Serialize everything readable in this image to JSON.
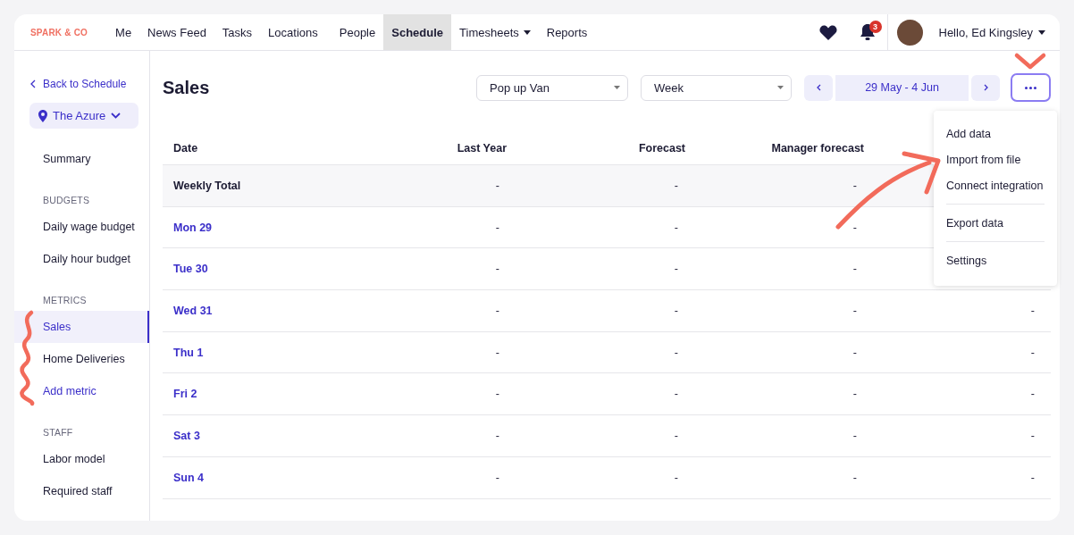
{
  "brand": "SPARK & CO",
  "nav": [
    {
      "label": "Me",
      "selected": false,
      "dropdown": false
    },
    {
      "label": "News Feed",
      "selected": false,
      "dropdown": false
    },
    {
      "label": "Tasks",
      "selected": false,
      "dropdown": false
    },
    {
      "label": "Locations",
      "selected": false,
      "dropdown": false
    },
    {
      "label": "People",
      "selected": false,
      "dropdown": false
    },
    {
      "label": "Schedule",
      "selected": true,
      "dropdown": false
    },
    {
      "label": "Timesheets",
      "selected": false,
      "dropdown": true
    },
    {
      "label": "Reports",
      "selected": false,
      "dropdown": false
    }
  ],
  "notifications": {
    "count": "3"
  },
  "user": {
    "greeting": "Hello, Ed Kingsley"
  },
  "sidebar": {
    "back_link": "Back to Schedule",
    "location": "The Azure",
    "sections": [
      {
        "items": [
          {
            "label": "Summary",
            "selected": false,
            "kind": "page"
          }
        ]
      },
      {
        "heading": "BUDGETS",
        "items": [
          {
            "label": "Daily wage budget",
            "selected": false,
            "kind": "page"
          },
          {
            "label": "Daily hour budget",
            "selected": false,
            "kind": "page"
          }
        ]
      },
      {
        "heading": "METRICS",
        "items": [
          {
            "label": "Sales",
            "selected": true,
            "kind": "page"
          },
          {
            "label": "Home Deliveries",
            "selected": false,
            "kind": "page"
          },
          {
            "label": "Add metric",
            "selected": false,
            "kind": "action"
          }
        ]
      },
      {
        "heading": "STAFF",
        "items": [
          {
            "label": "Labor model",
            "selected": false,
            "kind": "page"
          },
          {
            "label": "Required staff",
            "selected": false,
            "kind": "page"
          }
        ]
      }
    ]
  },
  "page": {
    "title": "Sales",
    "filters": [
      {
        "value": "Pop up Van"
      },
      {
        "value": "Week"
      }
    ],
    "date_range": "29 May - 4 Jun"
  },
  "menu": {
    "groups": [
      [
        "Add data",
        "Import from file",
        "Connect integration"
      ],
      [
        "Export data"
      ],
      [
        "Settings"
      ]
    ]
  },
  "table": {
    "columns": [
      "Date",
      "Last Year",
      "Forecast",
      "Manager forecast"
    ],
    "rows": [
      {
        "kind": "total",
        "cells": [
          "Weekly Total",
          "-",
          "-",
          "-"
        ]
      },
      {
        "kind": "day",
        "cells": [
          "Mon 29",
          "-",
          "-",
          "-"
        ]
      },
      {
        "kind": "day",
        "cells": [
          "Tue 30",
          "-",
          "-",
          "-"
        ]
      },
      {
        "kind": "day",
        "cells": [
          "Wed 31",
          "-",
          "-",
          "-",
          "-"
        ]
      },
      {
        "kind": "day",
        "cells": [
          "Thu 1",
          "-",
          "-",
          "-",
          "-"
        ]
      },
      {
        "kind": "day",
        "cells": [
          "Fri 2",
          "-",
          "-",
          "-",
          "-"
        ]
      },
      {
        "kind": "day",
        "cells": [
          "Sat 3",
          "-",
          "-",
          "-",
          "-"
        ]
      },
      {
        "kind": "day",
        "cells": [
          "Sun 4",
          "-",
          "-",
          "-",
          "-"
        ]
      }
    ]
  }
}
